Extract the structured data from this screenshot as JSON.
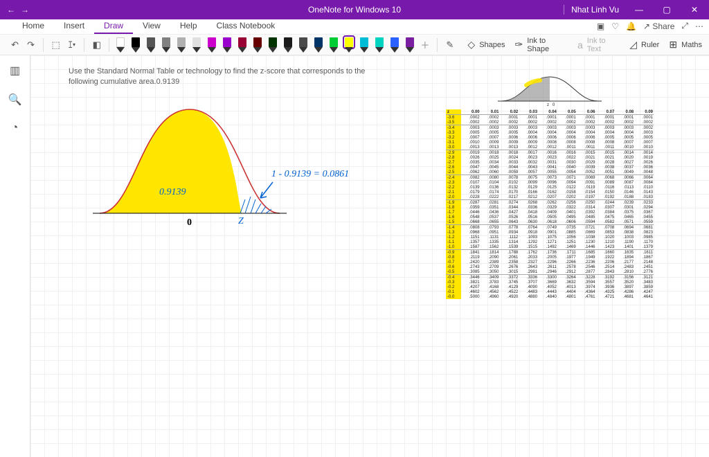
{
  "titlebar": {
    "back": "←",
    "fwd": "→",
    "title": "OneNote for Windows 10",
    "user": "Nhat Linh Vu",
    "share": "Share"
  },
  "tabs": {
    "items": [
      "Home",
      "Insert",
      "Draw",
      "View",
      "Help",
      "Class Notebook"
    ],
    "active": 2
  },
  "tools": {
    "shapes": "Shapes",
    "ink_to_shape": "Ink to Shape",
    "ink_to_text": "Ink to Text",
    "ruler": "Ruler",
    "maths": "Maths"
  },
  "pens": {
    "colors": [
      "#ffffff",
      "#000000",
      "#555555",
      "#808080",
      "#b0b0b0",
      "#e0e0e0",
      "#cc00cc",
      "#9900cc",
      "#990033",
      "#660000",
      "#003300",
      "#1a1a1a",
      "#4b4b4b",
      "#003366",
      "#00cc33",
      "#ffff00",
      "#00bcd4",
      "#00d4c0",
      "#2962ff",
      "#7b1fa2"
    ],
    "selected": 15
  },
  "prompt": "Use the Standard Normal Table or technology to find the z-score that corresponds to the following cumulative area.0.9139",
  "sketch": {
    "area_label": "0.9139",
    "eq": "1 - 0.9139 =   0.0861",
    "zero": "0",
    "z": "Z"
  },
  "ztable": {
    "header": [
      "z",
      "0.00",
      "0.01",
      "0.02",
      "0.03",
      "0.04",
      "0.05",
      "0.06",
      "0.07",
      "0.08",
      "0.09"
    ],
    "groups": [
      [
        [
          "-3.6",
          ".0002",
          ".0002",
          ".0001",
          ".0001",
          ".0001",
          ".0001",
          ".0001",
          ".0001",
          ".0001",
          ".0001"
        ],
        [
          "-3.5",
          ".0002",
          ".0002",
          ".0002",
          ".0002",
          ".0002",
          ".0002",
          ".0002",
          ".0002",
          ".0002",
          ".0002"
        ]
      ],
      [
        [
          "-3.4",
          ".0003",
          ".0003",
          ".0003",
          ".0003",
          ".0003",
          ".0003",
          ".0003",
          ".0003",
          ".0003",
          ".0002"
        ],
        [
          "-3.3",
          ".0005",
          ".0005",
          ".0005",
          ".0004",
          ".0004",
          ".0004",
          ".0004",
          ".0004",
          ".0004",
          ".0003"
        ],
        [
          "-3.2",
          ".0007",
          ".0007",
          ".0006",
          ".0006",
          ".0006",
          ".0006",
          ".0006",
          ".0005",
          ".0005",
          ".0005"
        ],
        [
          "-3.1",
          ".0010",
          ".0009",
          ".0009",
          ".0009",
          ".0008",
          ".0008",
          ".0008",
          ".0008",
          ".0007",
          ".0007"
        ],
        [
          "-3.0",
          ".0013",
          ".0013",
          ".0013",
          ".0012",
          ".0012",
          ".0011",
          ".0011",
          ".0011",
          ".0010",
          ".0010"
        ]
      ],
      [
        [
          "-2.9",
          ".0019",
          ".0018",
          ".0018",
          ".0017",
          ".0016",
          ".0016",
          ".0015",
          ".0015",
          ".0014",
          ".0014"
        ],
        [
          "-2.8",
          ".0026",
          ".0025",
          ".0024",
          ".0023",
          ".0023",
          ".0022",
          ".0021",
          ".0021",
          ".0020",
          ".0019"
        ],
        [
          "-2.7",
          ".0035",
          ".0034",
          ".0033",
          ".0032",
          ".0031",
          ".0030",
          ".0029",
          ".0028",
          ".0027",
          ".0026"
        ],
        [
          "-2.6",
          ".0047",
          ".0045",
          ".0044",
          ".0043",
          ".0041",
          ".0040",
          ".0039",
          ".0038",
          ".0037",
          ".0036"
        ],
        [
          "-2.5",
          ".0062",
          ".0060",
          ".0059",
          ".0057",
          ".0055",
          ".0054",
          ".0052",
          ".0051",
          ".0049",
          ".0048"
        ]
      ],
      [
        [
          "-2.4",
          ".0082",
          ".0080",
          ".0078",
          ".0075",
          ".0073",
          ".0071",
          ".0069",
          ".0068",
          ".0066",
          ".0064"
        ],
        [
          "-2.3",
          ".0107",
          ".0104",
          ".0102",
          ".0099",
          ".0096",
          ".0094",
          ".0091",
          ".0089",
          ".0087",
          ".0084"
        ],
        [
          "-2.2",
          ".0139",
          ".0136",
          ".0132",
          ".0129",
          ".0125",
          ".0122",
          ".0119",
          ".0116",
          ".0113",
          ".0110"
        ],
        [
          "-2.1",
          ".0179",
          ".0174",
          ".0170",
          ".0166",
          ".0162",
          ".0158",
          ".0154",
          ".0150",
          ".0146",
          ".0143"
        ],
        [
          "-2.0",
          ".0228",
          ".0222",
          ".0217",
          ".0212",
          ".0207",
          ".0202",
          ".0197",
          ".0192",
          ".0188",
          ".0183"
        ]
      ],
      [
        [
          "-1.9",
          ".0287",
          ".0281",
          ".0274",
          ".0268",
          ".0262",
          ".0256",
          ".0250",
          ".0244",
          ".0239",
          ".0233"
        ],
        [
          "-1.8",
          ".0359",
          ".0351",
          ".0344",
          ".0336",
          ".0329",
          ".0322",
          ".0314",
          ".0307",
          ".0301",
          ".0294"
        ],
        [
          "-1.7",
          ".0446",
          ".0436",
          ".0427",
          ".0418",
          ".0409",
          ".0401",
          ".0392",
          ".0384",
          ".0375",
          ".0367"
        ],
        [
          "-1.6",
          ".0548",
          ".0537",
          ".0526",
          ".0516",
          ".0505",
          ".0495",
          ".0485",
          ".0475",
          ".0465",
          ".0455"
        ],
        [
          "-1.5",
          ".0668",
          ".0655",
          ".0643",
          ".0630",
          ".0618",
          ".0606",
          ".0594",
          ".0582",
          ".0571",
          ".0559"
        ]
      ],
      [
        [
          "-1.4",
          ".0808",
          ".0793",
          ".0778",
          ".0764",
          ".0749",
          ".0735",
          ".0721",
          ".0708",
          ".0694",
          ".0681"
        ],
        [
          "-1.3",
          ".0968",
          ".0951",
          ".0934",
          ".0918",
          ".0901",
          ".0885",
          ".0869",
          ".0853",
          ".0838",
          ".0823"
        ],
        [
          "-1.2",
          ".1151",
          ".1131",
          ".1112",
          ".1093",
          ".1075",
          ".1056",
          ".1038",
          ".1020",
          ".1003",
          ".0985"
        ],
        [
          "-1.1",
          ".1357",
          ".1335",
          ".1314",
          ".1292",
          ".1271",
          ".1251",
          ".1230",
          ".1210",
          ".1190",
          ".1170"
        ],
        [
          "-1.0",
          ".1587",
          ".1562",
          ".1539",
          ".1515",
          ".1492",
          ".1469",
          ".1446",
          ".1423",
          ".1401",
          ".1379"
        ]
      ],
      [
        [
          "-0.9",
          ".1841",
          ".1814",
          ".1788",
          ".1762",
          ".1736",
          ".1711",
          ".1685",
          ".1660",
          ".1635",
          ".1611"
        ],
        [
          "-0.8",
          ".2119",
          ".2090",
          ".2061",
          ".2033",
          ".2005",
          ".1977",
          ".1949",
          ".1922",
          ".1894",
          ".1867"
        ],
        [
          "-0.7",
          ".2420",
          ".2389",
          ".2358",
          ".2327",
          ".2296",
          ".2266",
          ".2236",
          ".2206",
          ".2177",
          ".2148"
        ],
        [
          "-0.6",
          ".2743",
          ".2709",
          ".2676",
          ".2643",
          ".2611",
          ".2578",
          ".2546",
          ".2514",
          ".2483",
          ".2451"
        ],
        [
          "-0.5",
          ".3085",
          ".3050",
          ".3015",
          ".2981",
          ".2946",
          ".2912",
          ".2877",
          ".2843",
          ".2810",
          ".2776"
        ]
      ],
      [
        [
          "-0.4",
          ".3446",
          ".3409",
          ".3372",
          ".3336",
          ".3300",
          ".3264",
          ".3228",
          ".3192",
          ".3156",
          ".3121"
        ],
        [
          "-0.3",
          ".3821",
          ".3783",
          ".3745",
          ".3707",
          ".3669",
          ".3632",
          ".3594",
          ".3557",
          ".3520",
          ".3483"
        ],
        [
          "-0.2",
          ".4207",
          ".4168",
          ".4129",
          ".4090",
          ".4052",
          ".4013",
          ".3974",
          ".3936",
          ".3897",
          ".3859"
        ],
        [
          "-0.1",
          ".4602",
          ".4562",
          ".4522",
          ".4483",
          ".4443",
          ".4404",
          ".4364",
          ".4325",
          ".4286",
          ".4247"
        ],
        [
          "-0.0",
          ".5000",
          ".4960",
          ".4920",
          ".4880",
          ".4840",
          ".4801",
          ".4761",
          ".4721",
          ".4681",
          ".4641"
        ]
      ]
    ]
  }
}
